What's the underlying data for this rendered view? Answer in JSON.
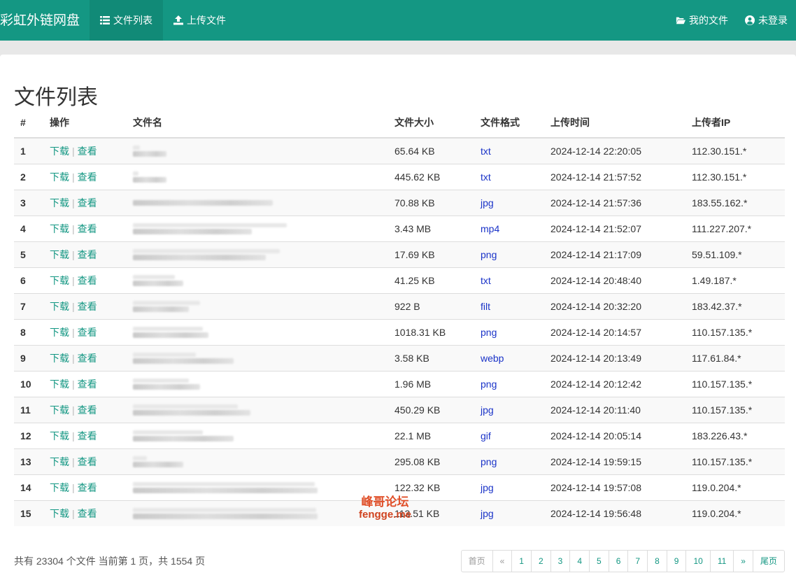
{
  "nav": {
    "brand": "彩虹外链网盘",
    "file_list": "文件列表",
    "upload": "上传文件",
    "my_files": "我的文件",
    "login": "未登录"
  },
  "page_title": "文件列表",
  "table": {
    "headers": [
      "#",
      "操作",
      "文件名",
      "文件大小",
      "文件格式",
      "上传时间",
      "上传者IP"
    ],
    "download_label": "下载",
    "view_label": "查看",
    "rows": [
      {
        "no": "1",
        "size": "65.64 KB",
        "format": "txt",
        "time": "2024-12-14 22:20:05",
        "ip": "112.30.151.*"
      },
      {
        "no": "2",
        "size": "445.62 KB",
        "format": "txt",
        "time": "2024-12-14 21:57:52",
        "ip": "112.30.151.*"
      },
      {
        "no": "3",
        "size": "70.88 KB",
        "format": "jpg",
        "time": "2024-12-14 21:57:36",
        "ip": "183.55.162.*"
      },
      {
        "no": "4",
        "size": "3.43 MB",
        "format": "mp4",
        "time": "2024-12-14 21:52:07",
        "ip": "111.227.207.*"
      },
      {
        "no": "5",
        "size": "17.69 KB",
        "format": "png",
        "time": "2024-12-14 21:17:09",
        "ip": "59.51.109.*"
      },
      {
        "no": "6",
        "size": "41.25 KB",
        "format": "txt",
        "time": "2024-12-14 20:48:40",
        "ip": "1.49.187.*"
      },
      {
        "no": "7",
        "size": "922 B",
        "format": "filt",
        "time": "2024-12-14 20:32:20",
        "ip": "183.42.37.*"
      },
      {
        "no": "8",
        "size": "1018.31 KB",
        "format": "png",
        "time": "2024-12-14 20:14:57",
        "ip": "110.157.135.*"
      },
      {
        "no": "9",
        "size": "3.58 KB",
        "format": "webp",
        "time": "2024-12-14 20:13:49",
        "ip": "117.61.84.*"
      },
      {
        "no": "10",
        "size": "1.96 MB",
        "format": "png",
        "time": "2024-12-14 20:12:42",
        "ip": "110.157.135.*"
      },
      {
        "no": "11",
        "size": "450.29 KB",
        "format": "jpg",
        "time": "2024-12-14 20:11:40",
        "ip": "110.157.135.*"
      },
      {
        "no": "12",
        "size": "22.1 MB",
        "format": "gif",
        "time": "2024-12-14 20:05:14",
        "ip": "183.226.43.*"
      },
      {
        "no": "13",
        "size": "295.08 KB",
        "format": "png",
        "time": "2024-12-14 19:59:15",
        "ip": "110.157.135.*"
      },
      {
        "no": "14",
        "size": "122.32 KB",
        "format": "jpg",
        "time": "2024-12-14 19:57:08",
        "ip": "119.0.204.*"
      },
      {
        "no": "15",
        "size": "113.51 KB",
        "format": "jpg",
        "time": "2024-12-14 19:56:48",
        "ip": "119.0.204.*"
      }
    ]
  },
  "footer": {
    "summary": "共有 23304 个文件  当前第 1 页，共 1554 页"
  },
  "watermark": {
    "line1": "峰哥论坛",
    "line2": "fengge.me"
  },
  "pagination": {
    "first": "首页",
    "prev": "«",
    "pages": [
      "1",
      "2",
      "3",
      "4",
      "5",
      "6",
      "7",
      "8",
      "9",
      "10",
      "11"
    ],
    "next": "»",
    "last": "尾页"
  }
}
